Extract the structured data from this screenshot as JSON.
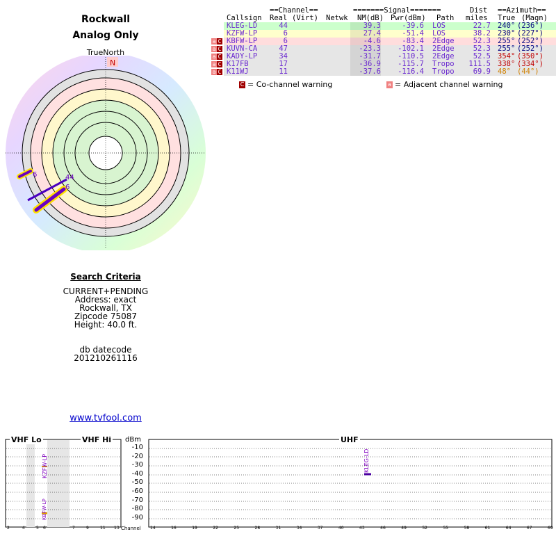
{
  "header": {
    "city": "Rockwall",
    "subtitle": "Analog Only"
  },
  "compass": {
    "label": "TrueNorth",
    "north": "N"
  },
  "table": {
    "group_headers": {
      "channel": "==Channel==",
      "signal": "=======Signal=======",
      "dist": "Dist",
      "azimuth": "==Azimuth=="
    },
    "columns": {
      "callsign": "Callsign",
      "real": "Real",
      "virt": "(Virt)",
      "netwk": "Netwk",
      "nm": "NM(dB)",
      "pwr": "Pwr(dBm)",
      "path": "Path",
      "miles": "miles",
      "true": "True",
      "magn": "(Magn)"
    },
    "rows": [
      {
        "callsign": "KLEG-LD",
        "real": "44",
        "virt": "",
        "nm": "39.3",
        "pwr": "-39.6",
        "path": "LOS",
        "miles": "22.7",
        "true": "240°",
        "magn": "(236°)",
        "bg": "#ccffcc",
        "color": "#6a28d0",
        "azcolor": "#000080",
        "warn": []
      },
      {
        "callsign": "KZFW-LP",
        "real": "6",
        "virt": "",
        "nm": "27.4",
        "pwr": "-51.4",
        "path": "LOS",
        "miles": "38.2",
        "true": "230°",
        "magn": "(227°)",
        "bg": "#ffffcc",
        "color": "#6a28d0",
        "azcolor": "#000080",
        "warn": []
      },
      {
        "callsign": "KBFW-LP",
        "real": "6",
        "virt": "",
        "nm": "-4.6",
        "pwr": "-83.4",
        "path": "2Edge",
        "miles": "52.3",
        "true": "255°",
        "magn": "(252°)",
        "bg": "#ffdddd",
        "color": "#6a28d0",
        "azcolor": "#000080",
        "warn": [
          "a",
          "C"
        ]
      },
      {
        "callsign": "KUVN-CA",
        "real": "47",
        "virt": "",
        "nm": "-23.3",
        "pwr": "-102.1",
        "path": "2Edge",
        "miles": "52.3",
        "true": "255°",
        "magn": "(252°)",
        "bg": "#e6e6e6",
        "color": "#6a28d0",
        "azcolor": "#000080",
        "warn": [
          "a",
          "C"
        ]
      },
      {
        "callsign": "KADY-LP",
        "real": "34",
        "virt": "",
        "nm": "-31.7",
        "pwr": "-110.5",
        "path": "2Edge",
        "miles": "52.5",
        "true": "354°",
        "magn": "(350°)",
        "bg": "#e6e6e6",
        "color": "#6a28d0",
        "azcolor": "#c00000",
        "warn": [
          "a",
          "C"
        ]
      },
      {
        "callsign": "K17FB",
        "real": "17",
        "virt": "",
        "nm": "-36.9",
        "pwr": "-115.7",
        "path": "Tropo",
        "miles": "111.5",
        "true": "338°",
        "magn": "(334°)",
        "bg": "#e6e6e6",
        "color": "#6a28d0",
        "azcolor": "#c00000",
        "warn": [
          "a",
          "C"
        ]
      },
      {
        "callsign": "K11WJ",
        "real": "11",
        "virt": "",
        "nm": "-37.6",
        "pwr": "-116.4",
        "path": "Tropo",
        "miles": "69.9",
        "true": "48°",
        "magn": "(44°)",
        "bg": "#e6e6e6",
        "color": "#6a28d0",
        "azcolor": "#d08000",
        "warn": [
          "a",
          "C"
        ]
      }
    ],
    "legend": {
      "co_symbol": "C",
      "co_text": "= Co-channel warning",
      "adj_symbol": "a",
      "adj_text": "= Adjacent channel warning"
    }
  },
  "polar_labels": [
    {
      "text": "6"
    },
    {
      "text": "44"
    },
    {
      "text": "6"
    }
  ],
  "search": {
    "title": "Search Criteria",
    "lines": [
      "CURRENT+PENDING",
      "Address: exact",
      "Rockwall, TX",
      "Zipcode 75087",
      "Height: 40.0 ft."
    ],
    "db_label": "db datecode",
    "db_value": "201210261116"
  },
  "site_link": "www.tvfool.com",
  "spectrum": {
    "vhf_lo": "VHF Lo",
    "vhf_hi": "VHF Hi",
    "uhf": "UHF",
    "dbm_label": "dBm",
    "dbm_ticks": [
      "-10",
      "-20",
      "-30",
      "-40",
      "-50",
      "-60",
      "-70",
      "-80",
      "-90"
    ],
    "channel_label": "Channel",
    "vhf_lo_channels": [
      "2",
      "4",
      "5",
      "6"
    ],
    "vhf_hi_channels": [
      "7",
      "9",
      "11",
      "13"
    ],
    "uhf_channels": [
      "14",
      "16",
      "19",
      "22",
      "25",
      "28",
      "31",
      "34",
      "37",
      "40",
      "43",
      "46",
      "49",
      "52",
      "55",
      "58",
      "61",
      "64",
      "67",
      "69"
    ],
    "signals": [
      {
        "label": "KLEG-LD",
        "dbm": -39.6
      },
      {
        "label": "KZFW-LP",
        "dbm": -51.4
      },
      {
        "label": "KBFW-LP",
        "dbm": -83.4
      }
    ]
  }
}
